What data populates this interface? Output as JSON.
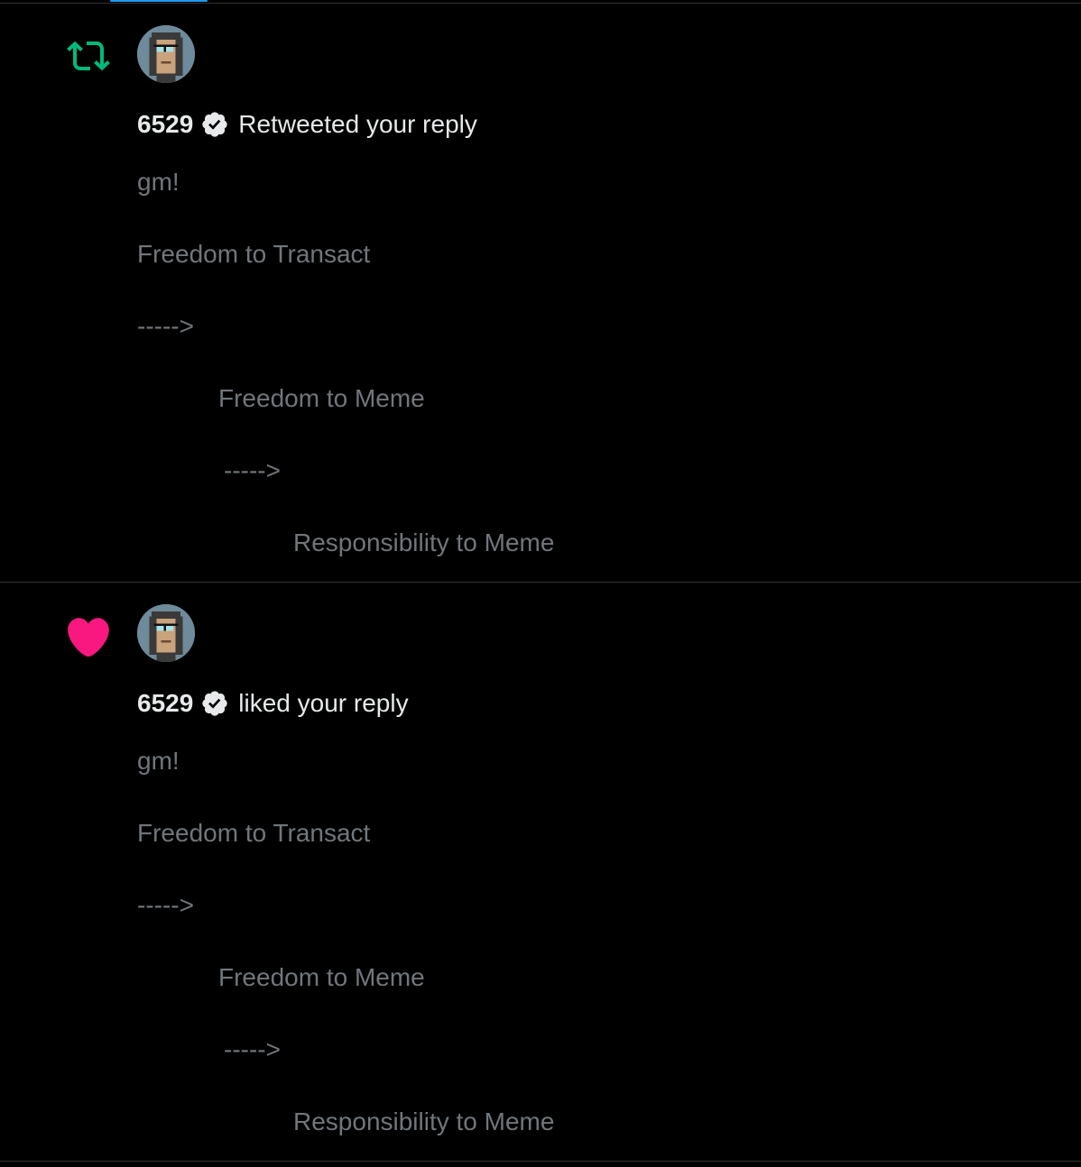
{
  "colors": {
    "background": "#000000",
    "retweet_green": "#00ba7c",
    "like_pink": "#f91880",
    "muted_text": "#71767b",
    "primary_text": "#e7e9ea"
  },
  "notifications": [
    {
      "type_icon": "retweet-icon",
      "username": "6529",
      "verified_icon": "verified-badge-icon",
      "action": "Retweeted your reply",
      "tweet_lines": [
        "gm!",
        "Freedom to Transact",
        "----->",
        "Freedom to Meme",
        "----->",
        "Responsibility to Meme"
      ]
    },
    {
      "type_icon": "heart-icon",
      "username": "6529",
      "verified_icon": "verified-badge-icon",
      "action": "liked your reply",
      "tweet_lines": [
        "gm!",
        "Freedom to Transact",
        "----->",
        "Freedom to Meme",
        "----->",
        "Responsibility to Meme"
      ]
    }
  ]
}
